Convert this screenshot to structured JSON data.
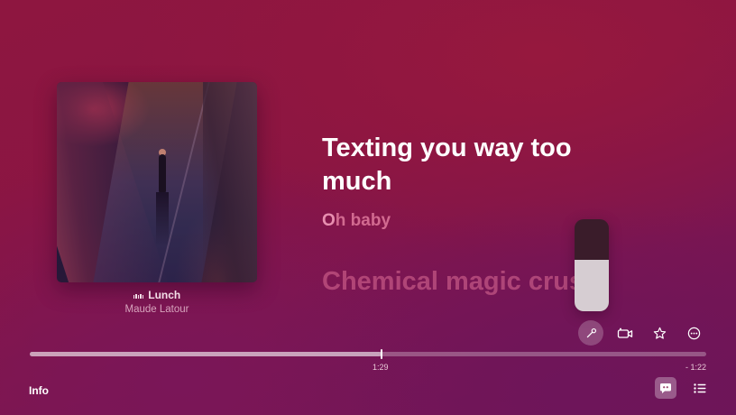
{
  "now_playing": {
    "title": "Lunch",
    "artist": "Maude Latour",
    "artwork": "album-artwork"
  },
  "lyrics": {
    "current": "Texting you way too much",
    "next_highlight": "O",
    "next_rest": "h baby",
    "upcoming": "Chemical magic crush"
  },
  "mic_level": 0.56,
  "controls": [
    {
      "name": "mic-button",
      "icon": "microphone-icon",
      "active": true
    },
    {
      "name": "camera-button",
      "icon": "camera-icon",
      "active": false
    },
    {
      "name": "favorite-button",
      "icon": "star-icon",
      "active": false
    },
    {
      "name": "more-button",
      "icon": "ellipsis-circle-icon",
      "active": false
    }
  ],
  "playback": {
    "elapsed": "1:29",
    "remaining": "- 1:22",
    "progress": 0.52
  },
  "bottom_bar": {
    "info_label": "Info",
    "lyrics_icon": "lyrics-bubble-icon",
    "queue_icon": "list-icon"
  },
  "colors": {
    "background": "#8a1543",
    "lyric_active": "#ffffff",
    "lyric_dim": "#d26a90"
  }
}
